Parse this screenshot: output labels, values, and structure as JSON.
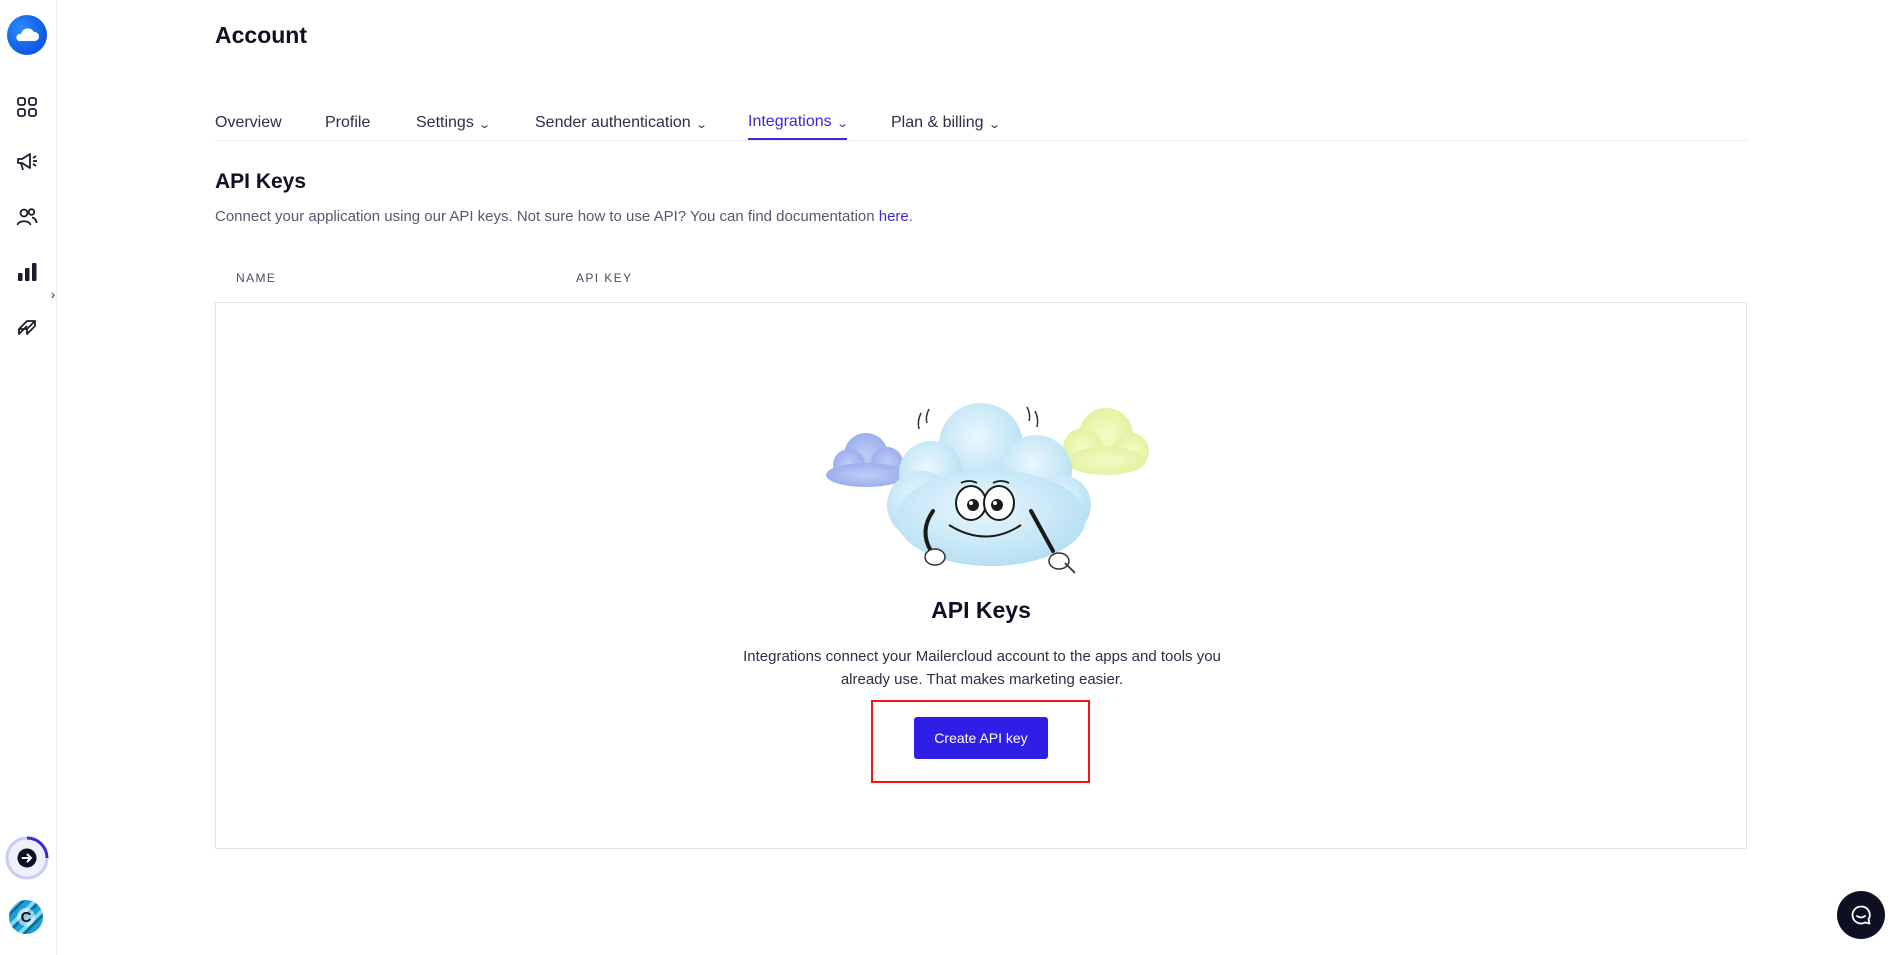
{
  "header": {
    "title": "Account"
  },
  "tabs": [
    {
      "label": "Overview",
      "dropdown": false,
      "active": false
    },
    {
      "label": "Profile",
      "dropdown": false,
      "active": false
    },
    {
      "label": "Settings",
      "dropdown": true,
      "active": false
    },
    {
      "label": "Sender authentication",
      "dropdown": true,
      "active": false
    },
    {
      "label": "Integrations",
      "dropdown": true,
      "active": true
    },
    {
      "label": "Plan & billing",
      "dropdown": true,
      "active": false
    }
  ],
  "section": {
    "title": "API Keys",
    "description": "Connect your application using our API keys. Not sure how to use API? You can find documentation ",
    "link_text": "here",
    "suffix": "."
  },
  "table": {
    "columns": [
      "NAME",
      "API KEY"
    ]
  },
  "empty_state": {
    "title": "API Keys",
    "description": "Integrations connect your Mailercloud account to the apps and tools you already use. That makes marketing easier.",
    "button_label": "Create API key"
  },
  "sidebar": {
    "icons": [
      "dashboard-icon",
      "campaigns-icon",
      "contacts-icon",
      "reports-icon",
      "automation-icon"
    ],
    "avatar_letter": "C"
  },
  "colors": {
    "accent": "#3b2ad6",
    "button": "#2f1ee6",
    "highlight": "#f01414"
  }
}
